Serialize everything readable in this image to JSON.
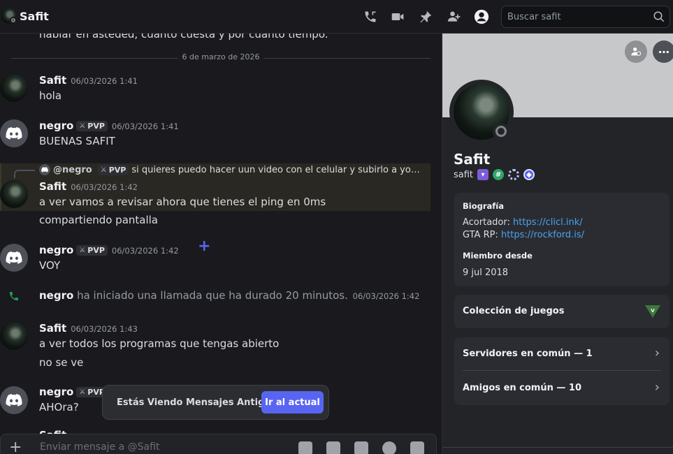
{
  "header": {
    "title": "Safit",
    "search_placeholder": "Buscar safit"
  },
  "chat": {
    "cut_line": "hablar en asteded, cuanto cuesta y por cuanto tiempo.",
    "date_divider": "6 de marzo de 2026",
    "messages": [
      {
        "user": "Safit",
        "time": "06/03/2026 1:41",
        "lines": [
          "hola"
        ]
      },
      {
        "user": "negro",
        "tag": "PVP",
        "time": "06/03/2026 1:41",
        "lines": [
          "BUENAS SAFIT"
        ]
      },
      {
        "user": "Safit",
        "time": "06/03/2026 1:42",
        "lines": [
          "a ver vamos a revisar ahora que tienes el ping en 0ms",
          "compartiendo pantalla"
        ]
      },
      {
        "user": "negro",
        "tag": "PVP",
        "time": "06/03/2026 1:42",
        "lines": [
          "VOY"
        ]
      },
      {
        "user": "Safit",
        "time": "06/03/2026 1:43",
        "lines": [
          "a ver todos los programas que tengas abierto",
          "no se ve"
        ]
      },
      {
        "user": "negro",
        "tag": "PVP",
        "time": "",
        "lines": [
          "AHOra?"
        ]
      }
    ],
    "reply": {
      "user": "@negro",
      "tag": "PVP",
      "text": "si quieres puedo hacer uun video con el celular y subirlo a youtube t..."
    },
    "call": {
      "user": "negro",
      "text": "ha iniciado una llamada que ha durado 20 minutos.",
      "time": "06/03/2026 1:42"
    },
    "partial_user": "Safit",
    "old_banner": {
      "text": "Estás Viendo Mensajes Antiguos",
      "button": "Ir al actual"
    },
    "composer_placeholder": "Enviar mensaje a @Safit"
  },
  "profile": {
    "display_name": "Safit",
    "username": "safit",
    "bio_heading": "Biografía",
    "bio": [
      {
        "label": "Acortador:",
        "link": "https://clicl.ink/"
      },
      {
        "label": "GTA RP:",
        "link": "https://rockford.is/"
      }
    ],
    "member_heading": "Miembro desde",
    "member_since": "9 jul 2018",
    "games_label": "Colección de juegos",
    "servers_label": "Servidores en común — 1",
    "friends_label": "Amigos en común — 10"
  }
}
